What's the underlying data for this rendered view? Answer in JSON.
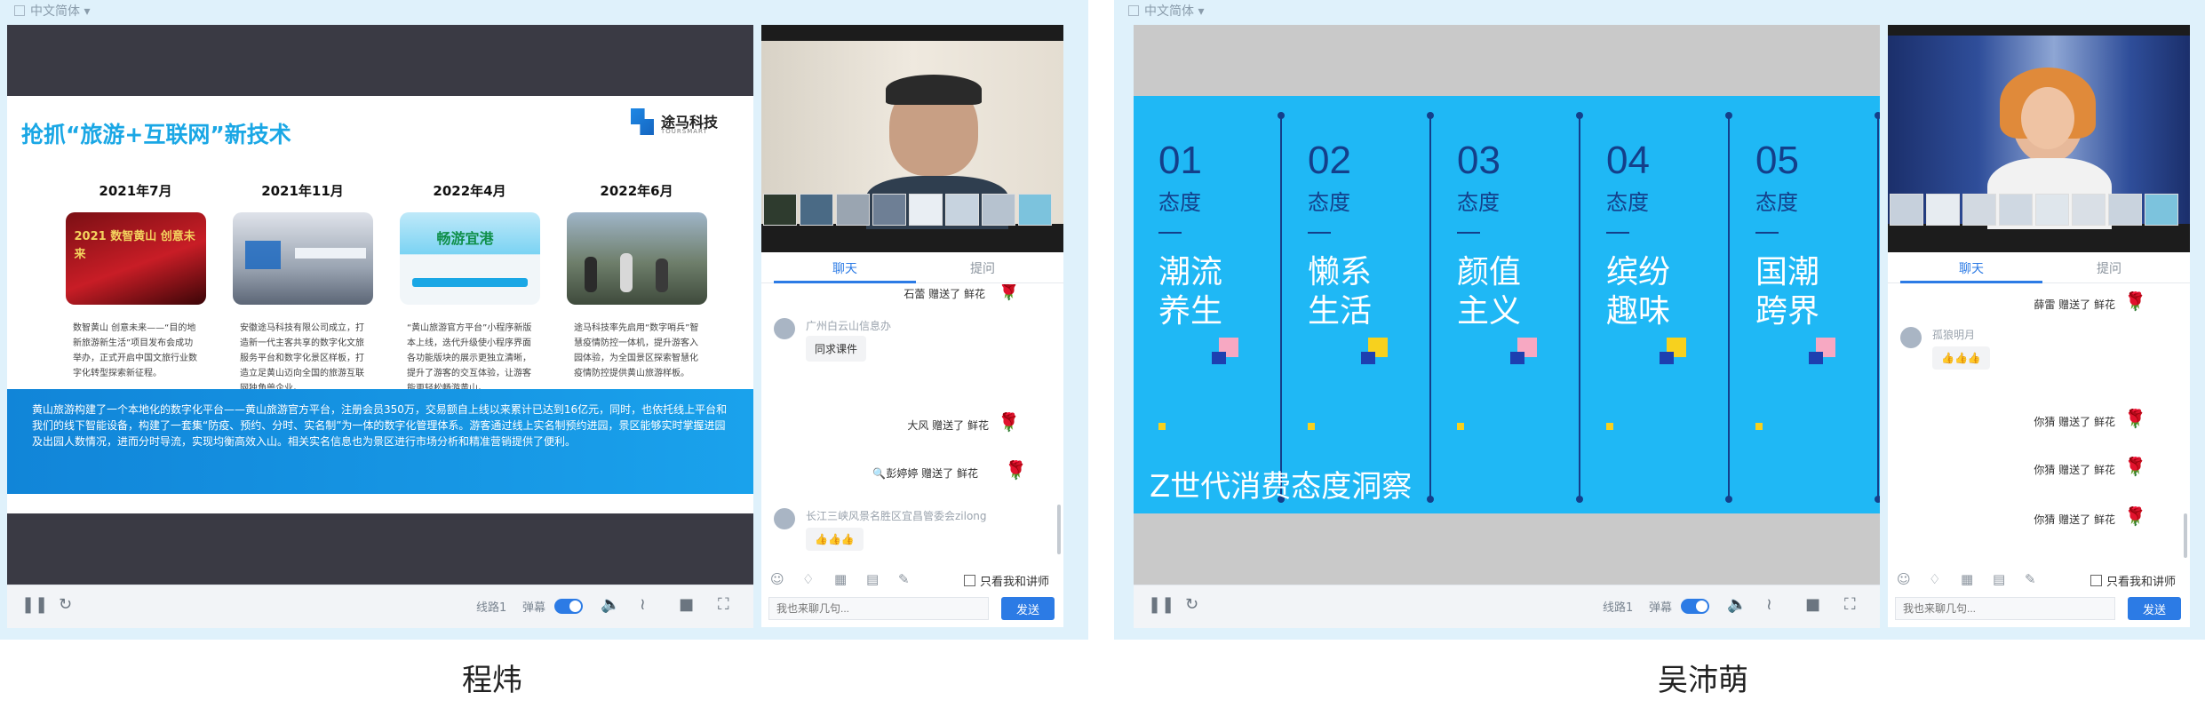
{
  "panels": [
    {
      "window_title": "中文简体",
      "player": {
        "line": "线路1",
        "danmaku": "弹幕"
      },
      "chat": {
        "tab_chat": "聊天",
        "tab_question": "提问",
        "messages": [
          {
            "type": "gift",
            "user": "石蕾",
            "text": "赠送了 鲜花"
          },
          {
            "type": "text",
            "user": "广州白云山信息办",
            "text": "同求课件"
          },
          {
            "type": "gift",
            "user": "大风",
            "text": "赠送了 鲜花"
          },
          {
            "type": "gift",
            "user": "彭婷婷",
            "text": "赠送了 鲜花"
          },
          {
            "type": "text",
            "user": "长江三峡风景名胜区宜昌管委会zilong",
            "text": "👍👍👍"
          }
        ],
        "only_me_label": "只看我和讲师",
        "input_placeholder": "我也来聊几句...",
        "send_label": "发送"
      },
      "slide": {
        "title": "抢抓“旅游+互联网”新技术",
        "logo": "途马科技",
        "logo_sub": "TOURSMART",
        "timeline": [
          {
            "date": "2021年7月",
            "image_text": "2021 数智黄山 创意未来",
            "text": "数智黄山 创意未来——“目的地新旅游新生活”项目发布会成功举办，正式开启中国文旅行业数字化转型探索新征程。"
          },
          {
            "date": "2021年11月",
            "image_text": "",
            "text": "安徽途马科技有限公司成立，打造新一代主客共享的数字化文旅服务平台和数字化景区样板，打造立足黄山迈向全国的旅游互联网独角兽企业。"
          },
          {
            "date": "2022年4月",
            "image_text": "畅游宜港",
            "text": "“黄山旅游官方平台”小程序新版本上线，迭代升级使小程序界面各功能版块的展示更独立清晰，提升了游客的交互体验，让游客能更轻松畅游黄山。"
          },
          {
            "date": "2022年6月",
            "image_text": "",
            "text": "途马科技率先启用“数字哨兵”智慧疫情防控一体机，提升游客入园体验，为全国景区探索智慧化疫情防控提供黄山旅游样板。"
          }
        ],
        "band_text": "黄山旅游构建了一个本地化的数字化平台——黄山旅游官方平台，注册会员350万，交易额自上线以来累计已达到16亿元，同时，也依托线上平台和我们的线下智能设备，构建了一套集“防疫、预约、分时、实名制”为一体的数字化管理体系。游客通过线上实名制预约进园，景区能够实时掌握进园及出园人数情况，进而分时导流，实现均衡高效入山。相关实名信息也为景区进行市场分析和精准营销提供了便利。"
      },
      "caption": "程炜"
    },
    {
      "window_title": "中文简体",
      "player": {
        "line": "线路1",
        "danmaku": "弹幕"
      },
      "chat": {
        "tab_chat": "聊天",
        "tab_question": "提问",
        "messages": [
          {
            "type": "gift",
            "user": "薛雷",
            "text": "赠送了 鲜花"
          },
          {
            "type": "text",
            "user": "孤狼明月",
            "text": "👍👍👍"
          },
          {
            "type": "gift",
            "user": "你猜",
            "text": "赠送了 鲜花"
          },
          {
            "type": "gift",
            "user": "你猜",
            "text": "赠送了 鲜花"
          },
          {
            "type": "gift",
            "user": "你猜",
            "text": "赠送了 鲜花"
          }
        ],
        "only_me_label": "只看我和讲师",
        "input_placeholder": "我也来聊几句...",
        "send_label": "发送"
      },
      "slide": {
        "items": [
          {
            "num": "01",
            "label": "态度",
            "word": "潮流养生"
          },
          {
            "num": "02",
            "label": "态度",
            "word": "懒系生活"
          },
          {
            "num": "03",
            "label": "态度",
            "word": "颜值主义"
          },
          {
            "num": "04",
            "label": "态度",
            "word": "缤纷趣味"
          },
          {
            "num": "05",
            "label": "态度",
            "word": "国潮跨界"
          }
        ],
        "footer": "Z世代消费态度洞察"
      },
      "caption": "吴沛萌"
    }
  ],
  "colors": {
    "accent": "#2c7be5",
    "slide_blue": "#1fb8f5",
    "navy": "#143f8a",
    "rose": "#d21f2a"
  },
  "icons": [
    "pause-icon",
    "refresh-icon",
    "volume-icon",
    "signal-icon",
    "camera-icon",
    "fullscreen-icon",
    "emoji-icon",
    "gift-icon",
    "calendar-icon",
    "document-icon",
    "pen-icon",
    "rose-icon"
  ]
}
